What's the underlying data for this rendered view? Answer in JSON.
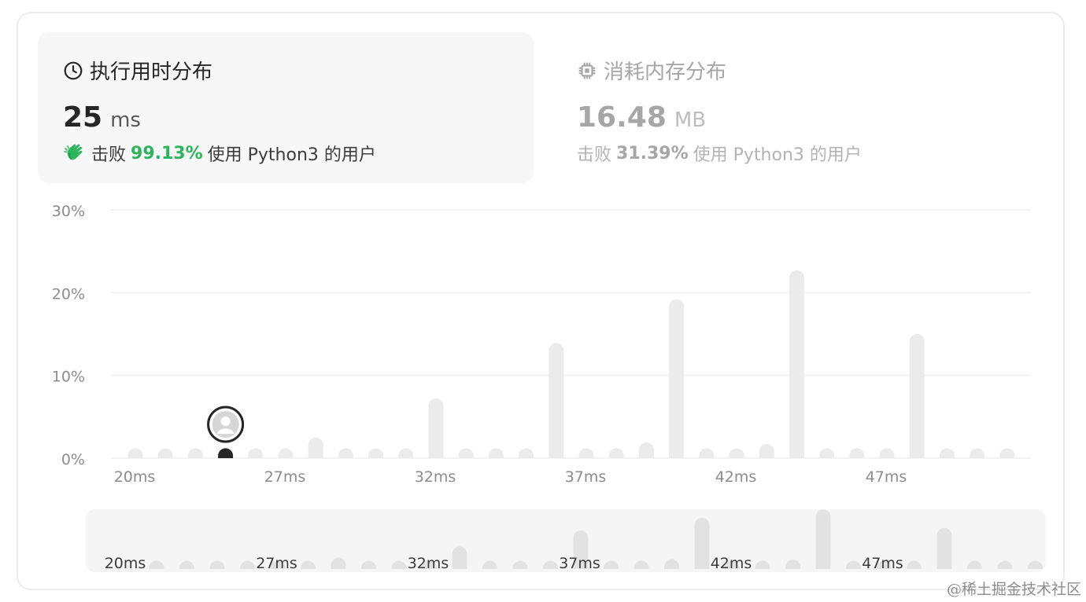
{
  "runtime": {
    "title": "执行用时分布",
    "value": "25",
    "unit": "ms",
    "beat_prefix": "击败",
    "beat_pct": "99.13%",
    "beat_suffix": "使用 Python3 的用户",
    "icon": "clock-icon",
    "hand_icon": "clapping-hands-icon"
  },
  "memory": {
    "title": "消耗内存分布",
    "value": "16.48",
    "unit": "MB",
    "beat_prefix": "击败",
    "beat_pct": "31.39%",
    "beat_suffix": "使用 Python3 的用户",
    "icon": "chip-icon"
  },
  "chart_data": {
    "type": "bar",
    "y_tick_labels": [
      "0%",
      "10%",
      "20%",
      "30%"
    ],
    "ylim": [
      0,
      30
    ],
    "x_tick_labels": [
      "20ms",
      "27ms",
      "32ms",
      "37ms",
      "42ms",
      "47ms"
    ],
    "x_tick_indices": [
      0,
      5,
      10,
      15,
      20,
      25
    ],
    "values": [
      0.3,
      0.3,
      0.3,
      0.3,
      0.3,
      0.3,
      1.6,
      0.3,
      0.3,
      0.3,
      6.3,
      0.3,
      0.3,
      0.3,
      13.0,
      0.3,
      0.3,
      1.0,
      18.3,
      0.3,
      0.3,
      0.8,
      21.8,
      0.3,
      0.3,
      0.3,
      14.1,
      0.3,
      0.3,
      0.3
    ],
    "highlight_index": 3,
    "highlight_marker": "user-avatar-icon",
    "colors": {
      "bar": "#ebebeb",
      "grid": "#efefef",
      "tick_text": "#8c8c8c",
      "highlight": "#262626",
      "overview_bg": "#f5f5f5",
      "overview_bar": "#e2e2e2",
      "overview_text": "#3c3c3c"
    }
  },
  "watermark": "@稀土掘金技术社区"
}
